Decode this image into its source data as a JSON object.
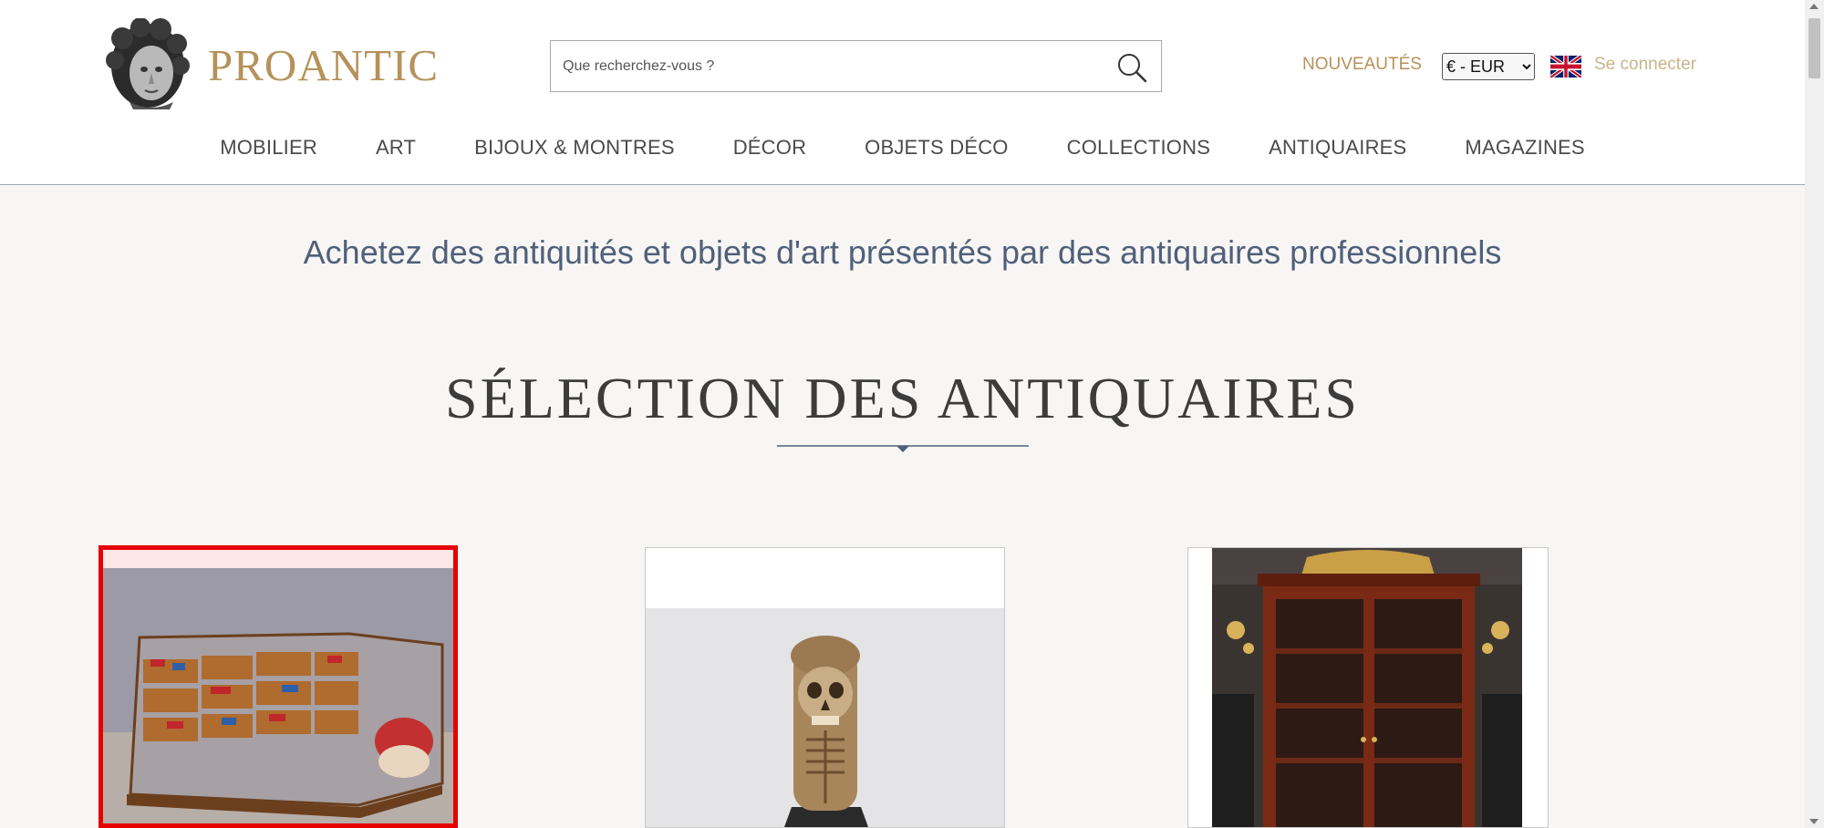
{
  "header": {
    "logo_text": "PROANTIC",
    "search": {
      "placeholder": "Que recherchez-vous ?"
    },
    "new_link": "NOUVEAUTÉS",
    "currency": {
      "selected": "€ - EUR",
      "options": [
        "€ - EUR"
      ]
    },
    "language_icon": "uk-flag-icon",
    "login": "Se connecter"
  },
  "nav": {
    "items": [
      {
        "label": "MOBILIER"
      },
      {
        "label": "ART"
      },
      {
        "label": "BIJOUX & MONTRES"
      },
      {
        "label": "DÉCOR"
      },
      {
        "label": "OBJETS DÉCO"
      },
      {
        "label": "COLLECTIONS"
      },
      {
        "label": "ANTIQUAIRES"
      },
      {
        "label": "MAGAZINES"
      }
    ]
  },
  "main": {
    "tagline": "Achetez des antiquités et objets d'art présentés par des antiquaires professionnels",
    "section_title": "SÉLECTION DES ANTIQUAIRES",
    "cards": [
      {
        "icon": "display-cabinet-image"
      },
      {
        "icon": "carved-skull-image"
      },
      {
        "icon": "bookcase-image"
      }
    ]
  },
  "colors": {
    "brand_gold": "#b5925a",
    "tagline_blue": "#50607a",
    "selection_red": "#e60000"
  }
}
